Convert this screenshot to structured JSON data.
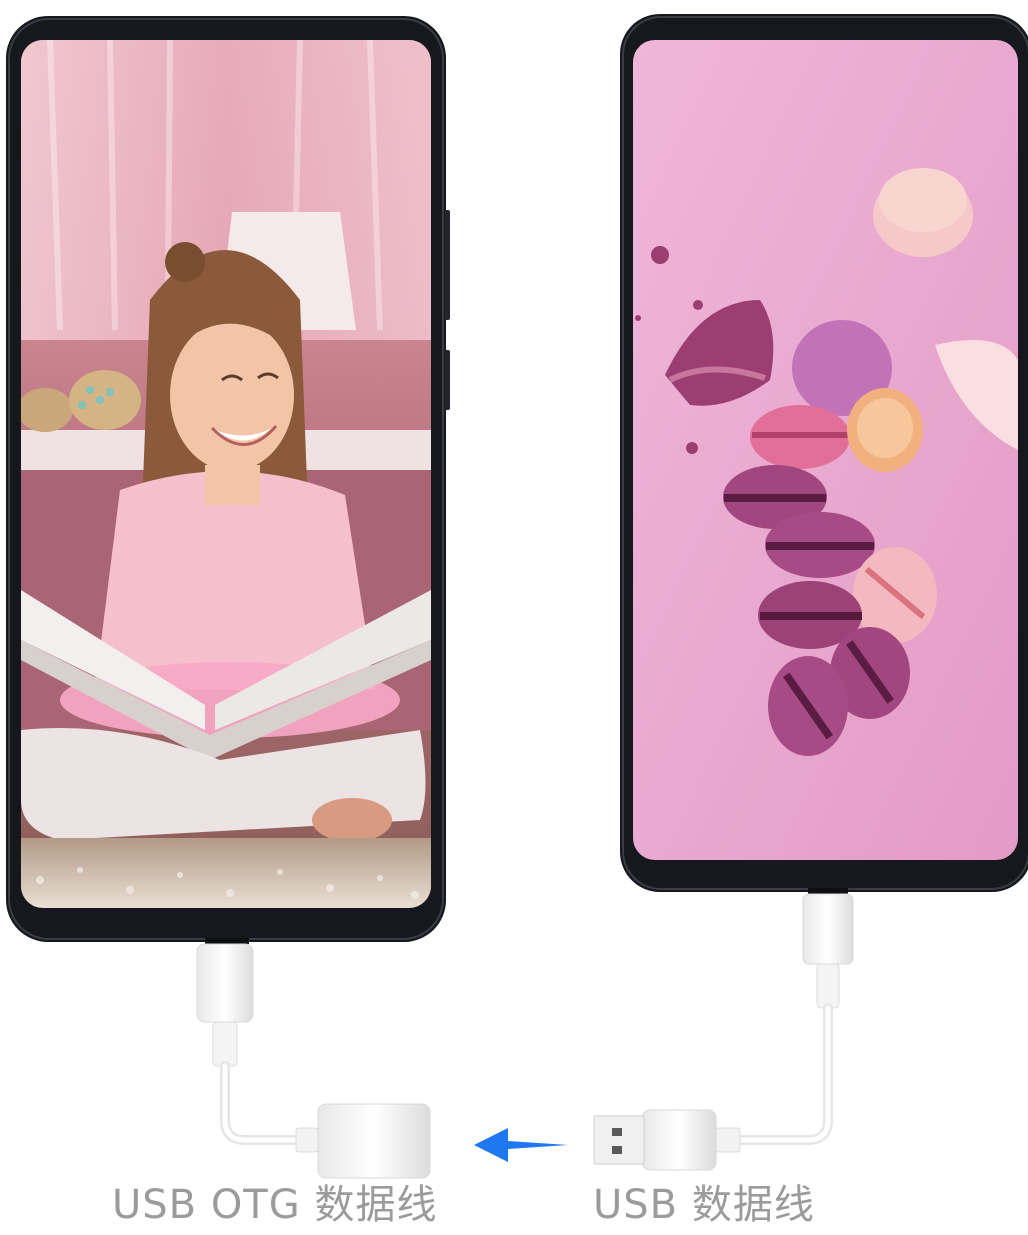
{
  "labels": {
    "left_cable": "USB OTG 数据线",
    "right_cable": "USB 数据线"
  },
  "colors": {
    "arrow": "#1f78f0",
    "label_text": "#9b9b9b",
    "phone_body": "#15171c",
    "left_screen_bg": "#d89aa8",
    "right_screen_bg": "#e8a9cf"
  },
  "icons": {
    "transfer_arrow": "arrow-left-icon"
  }
}
